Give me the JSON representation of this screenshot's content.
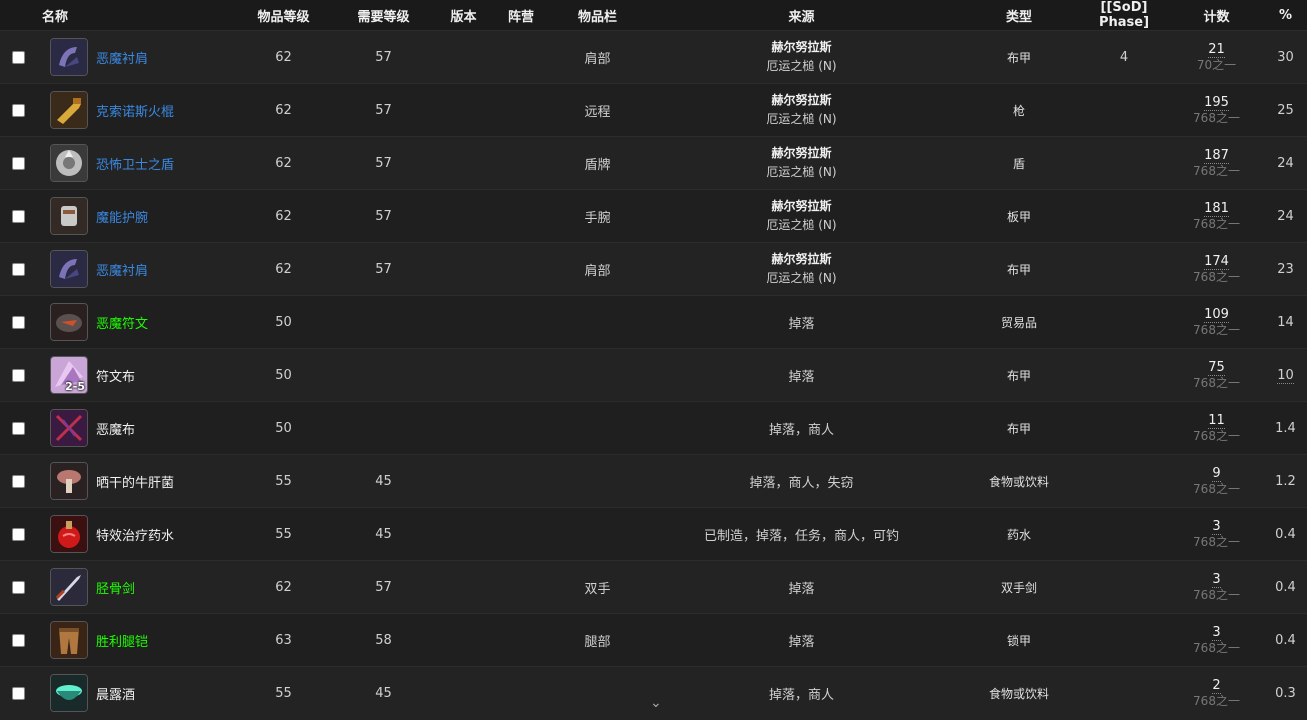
{
  "headers": {
    "name": "名称",
    "item_level": "物品等级",
    "req_level": "需要等级",
    "version": "版本",
    "faction": "阵营",
    "slot": "物品栏",
    "source": "来源",
    "type": "类型",
    "phase": "[[SoD] Phase]",
    "count": "计数",
    "pct": "%"
  },
  "rows": [
    {
      "name": "恶魔衬肩",
      "quality": "blue",
      "icon": "shoulder-icon",
      "ilvl": "62",
      "req": "57",
      "slot": "肩部",
      "src1": "赫尔努拉斯",
      "src2": "厄运之槌 (N)",
      "type": "布甲",
      "phase": "4",
      "count": "21",
      "of": "70之一",
      "pct": "30"
    },
    {
      "name": "克索诺斯火棍",
      "quality": "blue",
      "icon": "gun-icon",
      "ilvl": "62",
      "req": "57",
      "slot": "远程",
      "src1": "赫尔努拉斯",
      "src2": "厄运之槌 (N)",
      "type": "枪",
      "phase": "",
      "count": "195",
      "of": "768之一",
      "pct": "25"
    },
    {
      "name": "恐怖卫士之盾",
      "quality": "blue",
      "icon": "shield-icon",
      "ilvl": "62",
      "req": "57",
      "slot": "盾牌",
      "src1": "赫尔努拉斯",
      "src2": "厄运之槌 (N)",
      "type": "盾",
      "phase": "",
      "count": "187",
      "of": "768之一",
      "pct": "24"
    },
    {
      "name": "魔能护腕",
      "quality": "blue",
      "icon": "bracer-icon",
      "ilvl": "62",
      "req": "57",
      "slot": "手腕",
      "src1": "赫尔努拉斯",
      "src2": "厄运之槌 (N)",
      "type": "板甲",
      "phase": "",
      "count": "181",
      "of": "768之一",
      "pct": "24"
    },
    {
      "name": "恶魔衬肩",
      "quality": "blue",
      "icon": "shoulder-icon",
      "ilvl": "62",
      "req": "57",
      "slot": "肩部",
      "src1": "赫尔努拉斯",
      "src2": "厄运之槌 (N)",
      "type": "布甲",
      "phase": "",
      "count": "174",
      "of": "768之一",
      "pct": "23"
    },
    {
      "name": "恶魔符文",
      "quality": "green",
      "icon": "rune-stone-icon",
      "ilvl": "50",
      "req": "",
      "slot": "",
      "src1": "",
      "src2": "",
      "srconly": "掉落",
      "type": "贸易品",
      "phase": "",
      "count": "109",
      "of": "768之一",
      "pct": "14"
    },
    {
      "name": "符文布",
      "quality": "white",
      "icon": "cloth-icon",
      "stack": "2-5",
      "ilvl": "50",
      "req": "",
      "slot": "",
      "src1": "",
      "src2": "",
      "srconly": "掉落",
      "type": "布甲",
      "phase": "",
      "count": "75",
      "of": "768之一",
      "pct": "10",
      "pct_underline": true
    },
    {
      "name": "恶魔布",
      "quality": "white",
      "icon": "felcloth-icon",
      "ilvl": "50",
      "req": "",
      "slot": "",
      "src1": "",
      "src2": "",
      "srconly": "掉落，商人",
      "type": "布甲",
      "phase": "",
      "count": "11",
      "of": "768之一",
      "pct": "1.4"
    },
    {
      "name": "晒干的牛肝菌",
      "quality": "white",
      "icon": "mushroom-icon",
      "ilvl": "55",
      "req": "45",
      "slot": "",
      "src1": "",
      "src2": "",
      "srconly": "掉落，商人，失窃",
      "type": "食物或饮料",
      "phase": "",
      "count": "9",
      "of": "768之一",
      "pct": "1.2"
    },
    {
      "name": "特效治疗药水",
      "quality": "white",
      "icon": "potion-icon",
      "ilvl": "55",
      "req": "45",
      "slot": "",
      "src1": "",
      "src2": "",
      "srconly": "已制造，掉落，任务，商人，可钓",
      "type": "药水",
      "phase": "",
      "count": "3",
      "of": "768之一",
      "pct": "0.4"
    },
    {
      "name": "胫骨剑",
      "quality": "green",
      "icon": "sword-icon",
      "ilvl": "62",
      "req": "57",
      "slot": "双手",
      "src1": "",
      "src2": "",
      "srconly": "掉落",
      "type": "双手剑",
      "phase": "",
      "count": "3",
      "of": "768之一",
      "pct": "0.4"
    },
    {
      "name": "胜利腿铠",
      "quality": "green",
      "icon": "legs-icon",
      "ilvl": "63",
      "req": "58",
      "slot": "腿部",
      "src1": "",
      "src2": "",
      "srconly": "掉落",
      "type": "锁甲",
      "phase": "",
      "count": "3",
      "of": "768之一",
      "pct": "0.4"
    },
    {
      "name": "晨露酒",
      "quality": "white",
      "icon": "drink-icon",
      "ilvl": "55",
      "req": "45",
      "slot": "",
      "src1": "",
      "src2": "",
      "srconly": "掉落，商人",
      "type": "食物或饮料",
      "phase": "",
      "count": "2",
      "of": "768之一",
      "pct": "0.3"
    }
  ],
  "scroll_glyph": "⌄"
}
